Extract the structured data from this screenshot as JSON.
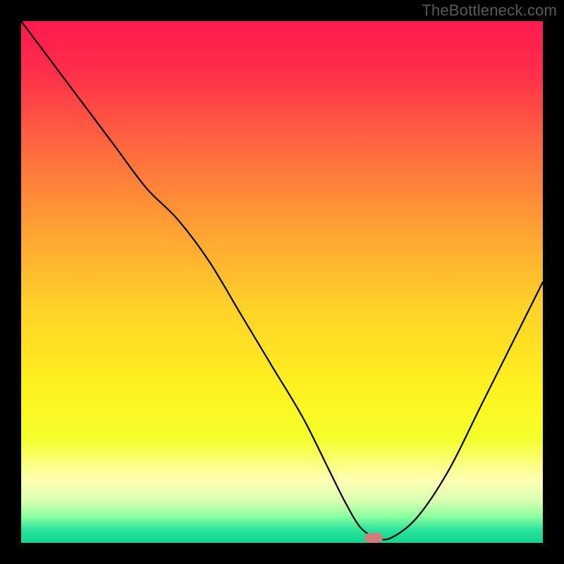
{
  "watermark": "TheBottleneck.com",
  "colors": {
    "background_black": "#000000",
    "watermark_gray": "#595959",
    "curve_black": "#000000",
    "marker_fill": "#cf7d7a",
    "gradient_stops": [
      {
        "offset": 0.0,
        "color": "#ff1a4f"
      },
      {
        "offset": 0.1,
        "color": "#ff2f4a"
      },
      {
        "offset": 0.25,
        "color": "#ff6b3e"
      },
      {
        "offset": 0.4,
        "color": "#ffa233"
      },
      {
        "offset": 0.55,
        "color": "#ffd228"
      },
      {
        "offset": 0.7,
        "color": "#fff11f"
      },
      {
        "offset": 0.8,
        "color": "#f3ff2a"
      },
      {
        "offset": 0.88,
        "color": "#ffffb5"
      },
      {
        "offset": 0.92,
        "color": "#d9ffb0"
      },
      {
        "offset": 0.95,
        "color": "#8affa0"
      },
      {
        "offset": 0.975,
        "color": "#2be29b"
      },
      {
        "offset": 1.0,
        "color": "#0fd690"
      }
    ]
  },
  "chart_data": {
    "type": "line",
    "title": "",
    "xlabel": "",
    "ylabel": "",
    "xlim": [
      0,
      100
    ],
    "ylim": [
      0,
      100
    ],
    "grid": false,
    "legend": false,
    "series": [
      {
        "name": "bottleneck-curve",
        "x": [
          0,
          6,
          12,
          18,
          24,
          30,
          36,
          42,
          48,
          54,
          59,
          62,
          65,
          68,
          71,
          76,
          82,
          88,
          94,
          100
        ],
        "y": [
          100,
          92,
          84,
          76,
          68,
          62,
          54,
          44,
          34,
          24,
          14,
          8,
          3,
          1,
          1,
          5,
          14,
          26,
          38,
          50
        ]
      }
    ],
    "annotations": [
      {
        "name": "min-marker",
        "shape": "pill",
        "x": 67.5,
        "y": 1,
        "color": "#cf7d7a"
      }
    ]
  }
}
